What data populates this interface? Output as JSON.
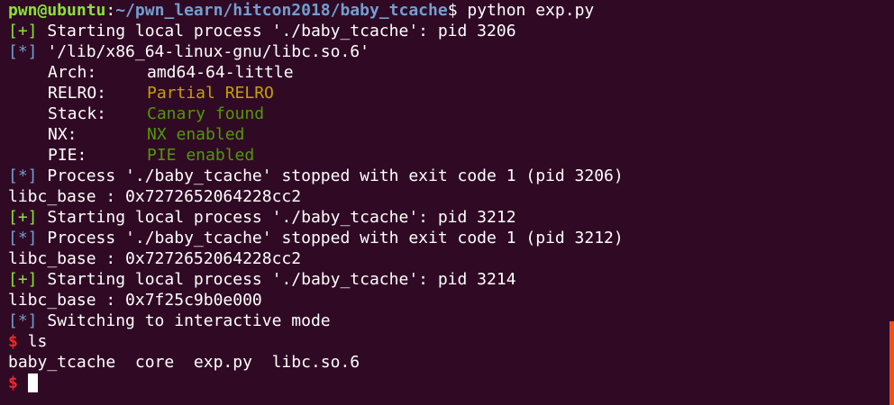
{
  "prompt": {
    "user_host": "pwn@ubuntu",
    "path_sep": ":",
    "path": "~/pwn_learn/hitcon2018/baby_tcache",
    "dollar_cmd": "$ python exp.py"
  },
  "lines": {
    "l1_tag": "[+]",
    "l1_text": " Starting local process './baby_tcache': pid 3206",
    "l2_tag": "[*]",
    "l2_text": " '/lib/x86_64-linux-gnu/libc.so.6'",
    "arch_label": "Arch:",
    "arch_value": "amd64-64-little",
    "relro_label": "RELRO:",
    "relro_value": "Partial RELRO",
    "stack_label": "Stack:",
    "stack_value": "Canary found",
    "nx_label": "NX:",
    "nx_value": "NX enabled",
    "pie_label": "PIE:",
    "pie_value": "PIE enabled",
    "l8_tag": "[*]",
    "l8_text": " Process './baby_tcache' stopped with exit code 1 (pid 3206)",
    "l9_text": "libc_base : 0x7272652064228cc2",
    "l10_tag": "[+]",
    "l10_text": " Starting local process './baby_tcache': pid 3212",
    "l11_tag": "[*]",
    "l11_text": " Process './baby_tcache' stopped with exit code 1 (pid 3212)",
    "l12_text": "libc_base : 0x7272652064228cc2",
    "l13_tag": "[+]",
    "l13_text": " Starting local process './baby_tcache': pid 3214",
    "l14_text": "libc_base : 0x7f25c9b0e000",
    "l15_tag": "[*]",
    "l15_text": " Switching to interactive mode",
    "dollar": "$",
    "l16_cmd": " ls",
    "l17_text": "baby_tcache  core  exp.py  libc.so.6",
    "l18_dollar": "$"
  },
  "colors": {
    "background": "#300a24",
    "green": "#8ae234",
    "blue": "#729fcf",
    "red": "#ef2929",
    "yellow": "#c4a000",
    "dark_green": "#4e9a06",
    "scrollbar": "#e95420"
  }
}
